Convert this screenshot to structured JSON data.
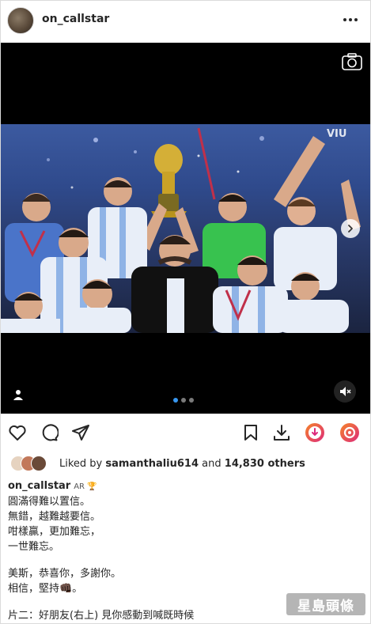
{
  "post": {
    "username": "on_callstar",
    "more_icon": "more-horizontal-icon"
  },
  "media": {
    "overlay_brand": "VIU",
    "carousel_count": 3,
    "carousel_active_index": 0
  },
  "likes": {
    "prefix": "Liked by",
    "first_liker": "samanthaliu614",
    "middle": "and",
    "others": "14,830 others"
  },
  "caption": {
    "username": "on_callstar",
    "badge": "AR 🏆",
    "lines": [
      "圓滿得難以置信。",
      "無錯，越難越要信。",
      "咁樣贏，更加難忘，",
      "一世難忘。",
      "",
      "美斯，恭喜你，多謝你。",
      "相信，堅持👊🏿。",
      "",
      "片二：好朋友(右上) 見你感動到喊既時候"
    ]
  },
  "watermark": "星島頭條",
  "colors": {
    "accent": "#3897f0",
    "text": "#262626",
    "reels_orange": "#f58529",
    "reels_pink": "#dd2a7b"
  }
}
